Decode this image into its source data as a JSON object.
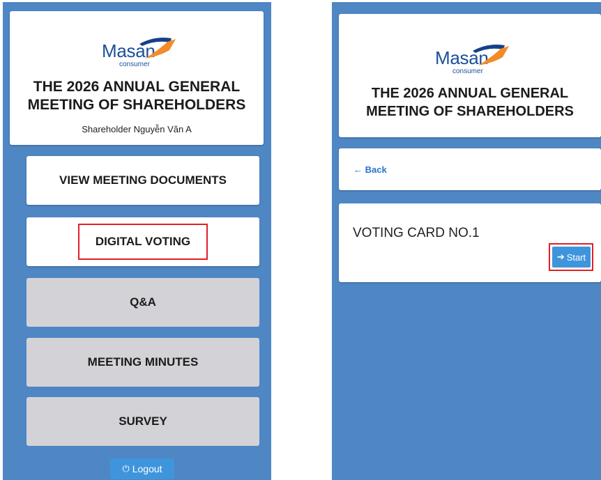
{
  "brand": {
    "name": "Masan",
    "sub": "consumer",
    "blue": "#1c4f9c",
    "orange": "#f28c28",
    "navy": "#173f8a"
  },
  "meeting": {
    "title_line1": "THE 2026 ANNUAL GENERAL",
    "title_line2": "MEETING OF SHAREHOLDERS"
  },
  "left": {
    "shareholder": "Shareholder Nguyễn Văn A",
    "menu": [
      {
        "label": "VIEW MEETING DOCUMENTS",
        "state": "active"
      },
      {
        "label": "DIGITAL VOTING",
        "state": "active",
        "highlighted": true
      },
      {
        "label": "Q&A",
        "state": "disabled"
      },
      {
        "label": "MEETING MINUTES",
        "state": "disabled"
      },
      {
        "label": "SURVEY",
        "state": "disabled"
      }
    ],
    "logout": {
      "icon": "power-icon",
      "label": "Logout"
    }
  },
  "right": {
    "back": {
      "icon": "arrow-left-icon",
      "label": "Back"
    },
    "voting_card": {
      "title": "VOTING CARD NO.1",
      "start": {
        "icon": "arrow-right-icon",
        "label": "Start",
        "highlighted": true
      }
    }
  },
  "colors": {
    "background": "#4f86c4",
    "card": "#ffffff",
    "disabled_button": "#d3d3d7",
    "accent": "#3f95dc",
    "highlight": "#e41e26"
  }
}
